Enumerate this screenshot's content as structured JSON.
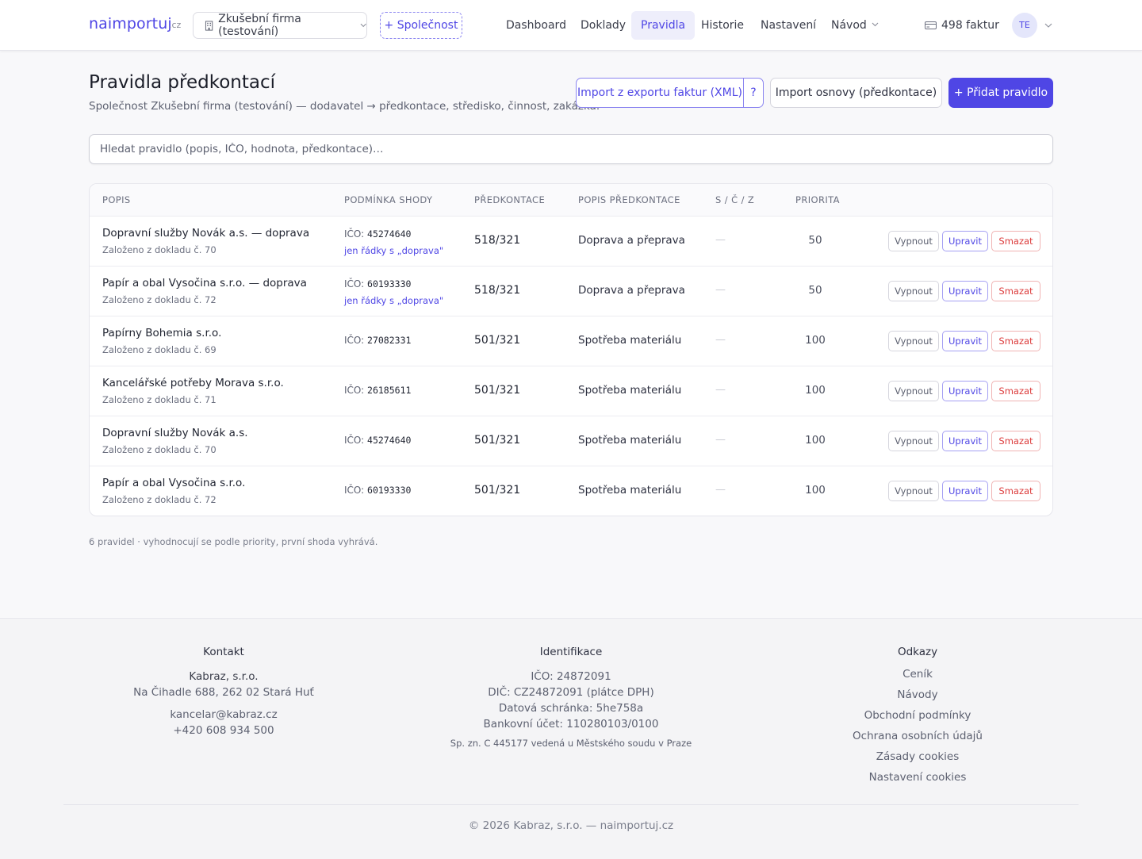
{
  "header": {
    "logo": "naimportuj",
    "logo_tld": ".cz",
    "company_select": "Zkušební firma (testování)",
    "add_company": "+ Společnost",
    "nav": [
      {
        "label": "Dashboard"
      },
      {
        "label": "Doklady"
      },
      {
        "label": "Pravidla",
        "active": true
      },
      {
        "label": "Historie"
      },
      {
        "label": "Nastavení"
      },
      {
        "label": "Návod"
      }
    ],
    "invoices": "498 faktur",
    "avatar": "TE"
  },
  "page": {
    "title": "Pravidla předkontací",
    "subtitle": "Společnost Zkušební firma (testování) — dodavatel → předkontace, středisko, činnost, zakázka.",
    "import_xml_label": "Import z exportu faktur (XML)",
    "import_xml_help": "?",
    "import_osnova_label": "Import osnovy (předkontace)",
    "add_rule_label": "+ Přidat pravidlo",
    "search_placeholder": "Hledat pravidlo (popis, IČO, hodnota, předkontace)…"
  },
  "table": {
    "columns": [
      "POPIS",
      "PODMÍNKA SHODY",
      "PŘEDKONTACE",
      "POPIS PŘEDKONTACE",
      "S / Č / Z",
      "PRIORITA"
    ],
    "ico_label": "IČO:",
    "empty_value": "—",
    "actions": {
      "disable": "Vypnout",
      "edit": "Upravit",
      "delete": "Smazat"
    },
    "rows": [
      {
        "desc": "Dopravní služby Novák a.s. — doprava",
        "sub": "Založeno z dokladu č. 70",
        "ico": "45274640",
        "note": "jen řádky s „doprava\"",
        "account": "518/321",
        "account_desc": "Doprava a přeprava",
        "scz": "—",
        "priority": "50"
      },
      {
        "desc": "Papír a obal Vysočina s.r.o. — doprava",
        "sub": "Založeno z dokladu č. 72",
        "ico": "60193330",
        "note": "jen řádky s „doprava\"",
        "account": "518/321",
        "account_desc": "Doprava a přeprava",
        "scz": "—",
        "priority": "50"
      },
      {
        "desc": "Papírny Bohemia s.r.o.",
        "sub": "Založeno z dokladu č. 69",
        "ico": "27082331",
        "note": "",
        "account": "501/321",
        "account_desc": "Spotřeba materiálu",
        "scz": "—",
        "priority": "100"
      },
      {
        "desc": "Kancelářské potřeby Morava s.r.o.",
        "sub": "Založeno z dokladu č. 71",
        "ico": "26185611",
        "note": "",
        "account": "501/321",
        "account_desc": "Spotřeba materiálu",
        "scz": "—",
        "priority": "100"
      },
      {
        "desc": "Dopravní služby Novák a.s.",
        "sub": "Založeno z dokladu č. 70",
        "ico": "45274640",
        "note": "",
        "account": "501/321",
        "account_desc": "Spotřeba materiálu",
        "scz": "—",
        "priority": "100"
      },
      {
        "desc": "Papír a obal Vysočina s.r.o.",
        "sub": "Založeno z dokladu č. 72",
        "ico": "60193330",
        "note": "",
        "account": "501/321",
        "account_desc": "Spotřeba materiálu",
        "scz": "—",
        "priority": "100"
      }
    ],
    "footnote": "6 pravidel · vyhodnocují se podle priority, první shoda vyhrává."
  },
  "footer": {
    "contact": {
      "heading": "Kontakt",
      "company": "Kabraz, s.r.o.",
      "address": "Na Čihadle 688, 262 02 Stará Huť",
      "email": "kancelar@kabraz.cz",
      "phone": "+420 608 934 500"
    },
    "identification": {
      "heading": "Identifikace",
      "ico": "IČO: 24872091",
      "dic": "DIČ: CZ24872091 (plátce DPH)",
      "databox": "Datová schránka: 5he758a",
      "bank": "Bankovní účet: 110280103/0100",
      "register": "Sp. zn. C 445177 vedená u Městského soudu v Praze"
    },
    "links": {
      "heading": "Odkazy",
      "items": [
        "Ceník",
        "Návody",
        "Obchodní podmínky",
        "Ochrana osobních údajů",
        "Zásady cookies",
        "Nastavení cookies"
      ]
    },
    "copyright": "© 2026 Kabraz, s.r.o. — naimportuj.cz"
  },
  "colors": {
    "accent": "#4f46e5",
    "danger": "#dc3b3b"
  }
}
